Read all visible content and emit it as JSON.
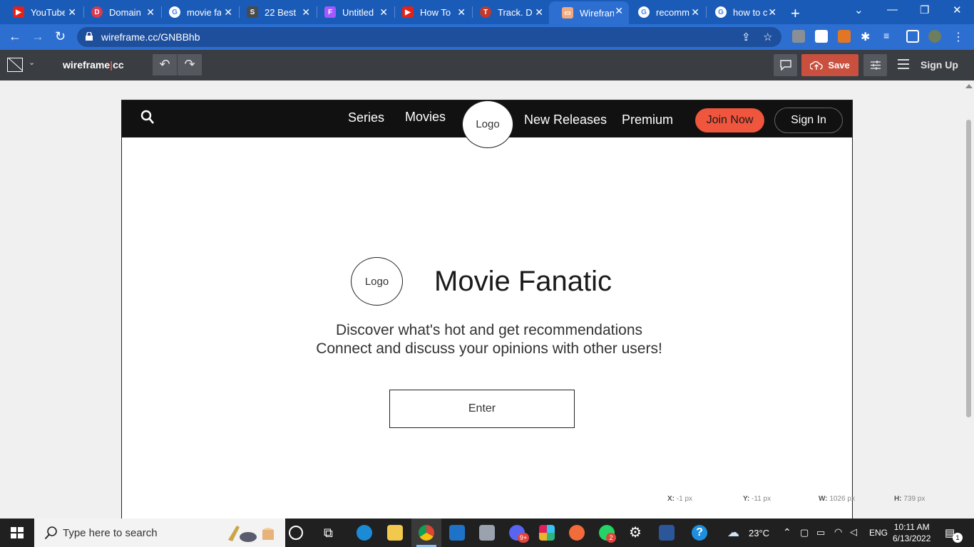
{
  "browser": {
    "tabs": [
      {
        "label": "YouTube",
        "icon": "youtube-icon",
        "color": "#e62117"
      },
      {
        "label": "Domain",
        "icon": "domain-icon",
        "color": "#d93a4f"
      },
      {
        "label": "movie fa",
        "icon": "google-icon",
        "color": "#ffffff"
      },
      {
        "label": "22 Best",
        "icon": "s-icon",
        "color": "#4a4a4a"
      },
      {
        "label": "Untitled",
        "icon": "figma-icon",
        "color": "#a259ff"
      },
      {
        "label": "How To",
        "icon": "youtube-icon",
        "color": "#e62117"
      },
      {
        "label": "Track. D",
        "icon": "track-icon",
        "color": "#c0392b"
      },
      {
        "label": "Wirefran",
        "icon": "wireframe-icon",
        "color": "#f2a97e"
      },
      {
        "label": "recomm",
        "icon": "google-icon",
        "color": "#ffffff"
      },
      {
        "label": "how to c",
        "icon": "google-icon",
        "color": "#ffffff"
      }
    ],
    "url": "wireframe.cc/GNBBhb"
  },
  "app": {
    "brand_left": "wireframe",
    "brand_sep": "|",
    "brand_right": "cc",
    "save_label": "Save",
    "signup_label": "Sign Up"
  },
  "site": {
    "nav": {
      "series": "Series",
      "movies": "Movies",
      "logo": "Logo",
      "new_releases": "New Releases",
      "premium": "Premium",
      "join": "Join Now",
      "signin": "Sign In"
    },
    "hero": {
      "logo": "Logo",
      "title": "Movie Fanatic",
      "sub1": "Discover what's hot and get recommendations",
      "sub2": "Connect and discuss your opinions with other users!",
      "enter": "Enter"
    }
  },
  "coords": {
    "x_label": "X:",
    "x_value": "-1 px",
    "y_label": "Y:",
    "y_value": "-11 px",
    "w_label": "W:",
    "w_value": "1026 px",
    "h_label": "H:",
    "h_value": "739 px"
  },
  "taskbar": {
    "search_placeholder": "Type here to search",
    "weather": "23°C",
    "lang": "ENG",
    "time": "10:11 AM",
    "date": "6/13/2022",
    "discord_badge": "9+",
    "whatsapp_badge": "2",
    "notif_count": "1"
  }
}
